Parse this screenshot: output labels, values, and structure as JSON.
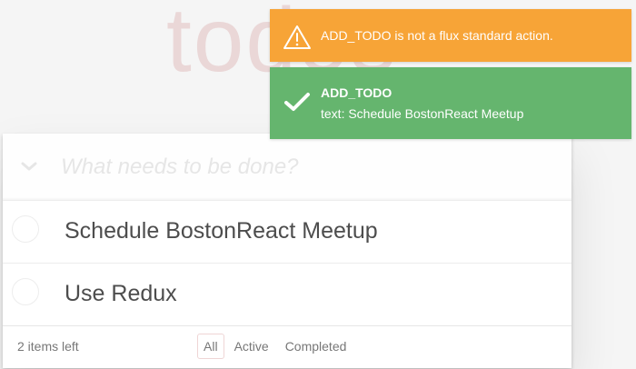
{
  "app": {
    "title": "todos"
  },
  "new_todo": {
    "placeholder": "What needs to be done?",
    "value": ""
  },
  "todos": [
    {
      "label": "Schedule BostonReact Meetup",
      "completed": false
    },
    {
      "label": "Use Redux",
      "completed": false
    }
  ],
  "footer": {
    "count_text": "2 items left",
    "filters": [
      "All",
      "Active",
      "Completed"
    ],
    "selected_filter": "All"
  },
  "notifications": {
    "warning": {
      "icon": "warning-icon",
      "message": "ADD_TODO is not a flux standard action.",
      "color": "#f7a437"
    },
    "success": {
      "icon": "checkmark-icon",
      "title": "ADD_TODO",
      "body": "text: Schedule BostonReact Meetup",
      "color": "#65b56e"
    }
  }
}
